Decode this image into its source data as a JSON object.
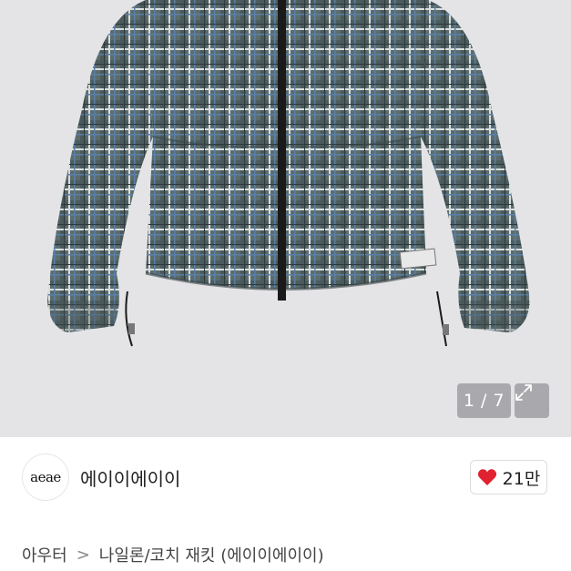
{
  "gallery": {
    "counter": "1 / 7",
    "expand_icon": "expand-icon",
    "accent_plaid": "#5f7070"
  },
  "shop": {
    "logo_text": "aeae",
    "name": "에이이에이이",
    "likes": "21만",
    "like_icon": "heart-icon",
    "heart_color": "#e0212f"
  },
  "breadcrumb": {
    "category": "아우터",
    "separator": ">",
    "item": "나일론/코치 재킷 (에이이에이이)"
  }
}
